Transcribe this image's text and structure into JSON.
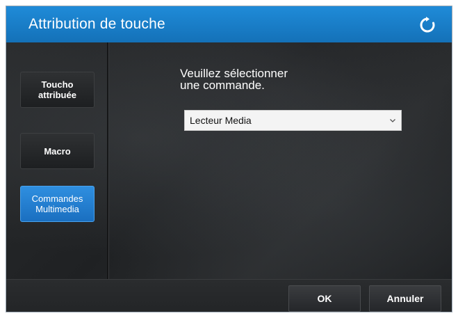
{
  "window": {
    "title": "Attribution de touche",
    "refresh_icon": "refresh-icon"
  },
  "sidebar": {
    "items": [
      {
        "label": "Toucho\nattribuée",
        "active": false
      },
      {
        "label": "Macro",
        "active": false
      },
      {
        "label": "Commandes\nMultimedia",
        "active": true
      }
    ]
  },
  "main": {
    "prompt": "Veuillez sélectionner\nune commande.",
    "command_select": {
      "value": "Lecteur Media",
      "icon": "chevron-down-icon"
    }
  },
  "footer": {
    "ok_label": "OK",
    "cancel_label": "Annuler"
  },
  "colors": {
    "titlebar": "#1a7fcc",
    "active_button": "#2580d4",
    "background": "#1f2123"
  }
}
